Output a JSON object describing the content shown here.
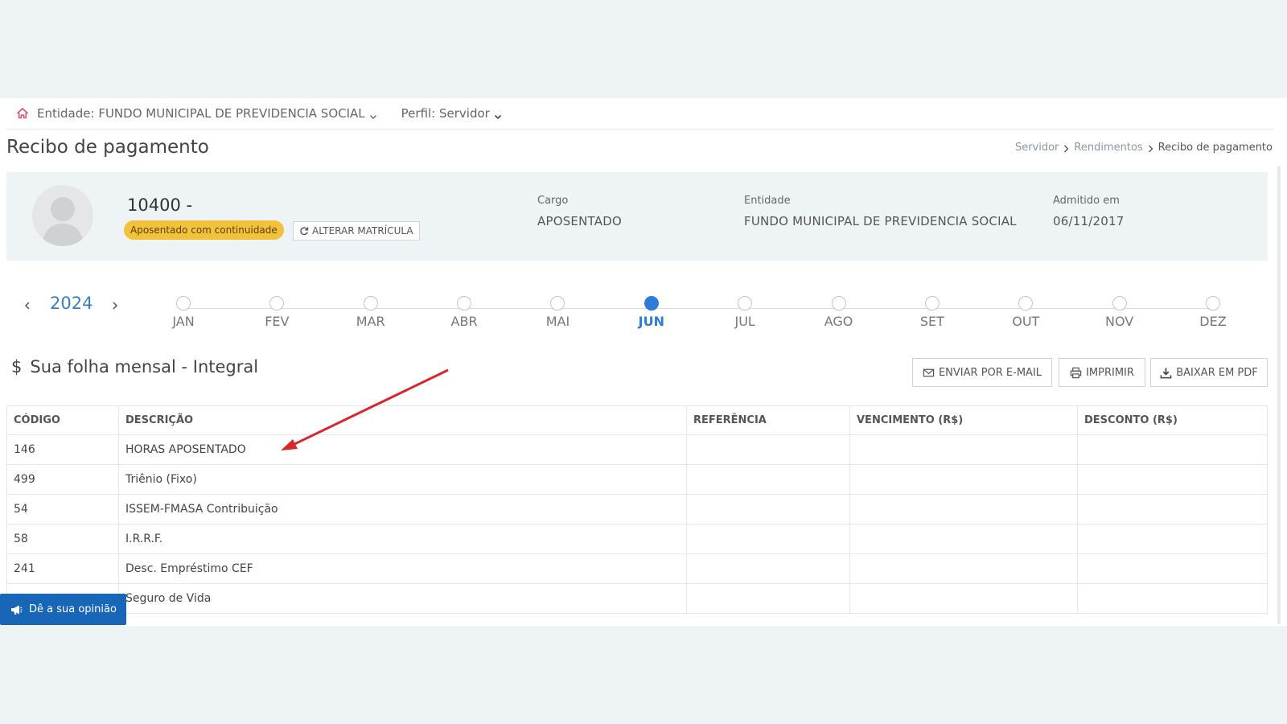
{
  "nav": {
    "entity_label": "Entidade: FUNDO MUNICIPAL DE PREVIDENCIA SOCIAL",
    "profile_label": "Perfil: Servidor"
  },
  "page": {
    "title": "Recibo de pagamento",
    "breadcrumb": [
      "Servidor",
      "Rendimentos",
      "Recibo de pagamento"
    ]
  },
  "profile": {
    "registration": "10400 -",
    "status_badge": "Aposentado com continuidade",
    "alter_button": "ALTERAR MATRÍCULA",
    "cargo_label": "Cargo",
    "cargo_value": "APOSENTADO",
    "entidade_label": "Entidade",
    "entidade_value": "FUNDO MUNICIPAL DE PREVIDENCIA SOCIAL",
    "admitido_label": "Admitido em",
    "admitido_value": "06/11/2017"
  },
  "timeline": {
    "year": "2024",
    "months": [
      "JAN",
      "FEV",
      "MAR",
      "ABR",
      "MAI",
      "JUN",
      "JUL",
      "AGO",
      "SET",
      "OUT",
      "NOV",
      "DEZ"
    ],
    "active_month": "JUN"
  },
  "section": {
    "title": "Sua folha mensal - Integral",
    "currency_symbol": "$",
    "email_button": "ENVIAR POR E-MAIL",
    "print_button": "IMPRIMIR",
    "pdf_button": "BAIXAR EM PDF"
  },
  "table": {
    "headers": [
      "CÓDIGO",
      "DESCRIÇÃO",
      "REFERÊNCIA",
      "VENCIMENTO (R$)",
      "DESCONTO (R$)"
    ],
    "rows": [
      {
        "codigo": "146",
        "descricao": "HORAS APOSENTADO",
        "referencia": "",
        "vencimento": "",
        "desconto": ""
      },
      {
        "codigo": "499",
        "descricao": "Triênio (Fixo)",
        "referencia": "",
        "vencimento": "",
        "desconto": ""
      },
      {
        "codigo": "54",
        "descricao": "ISSEM-FMASA Contribuição",
        "referencia": "",
        "vencimento": "",
        "desconto": ""
      },
      {
        "codigo": "58",
        "descricao": "I.R.R.F.",
        "referencia": "",
        "vencimento": "",
        "desconto": ""
      },
      {
        "codigo": "241",
        "descricao": "Desc. Empréstimo CEF",
        "referencia": "",
        "vencimento": "",
        "desconto": ""
      },
      {
        "codigo": "",
        "descricao": "Seguro de Vida",
        "referencia": "",
        "vencimento": "",
        "desconto": ""
      }
    ]
  },
  "feedback": {
    "label": "Dê a sua opinião"
  },
  "colors": {
    "accent": "#2f7bd8",
    "badge": "#f2c23a",
    "feedback_bg": "#1766b8",
    "annotation_arrow": "#d9262b"
  }
}
